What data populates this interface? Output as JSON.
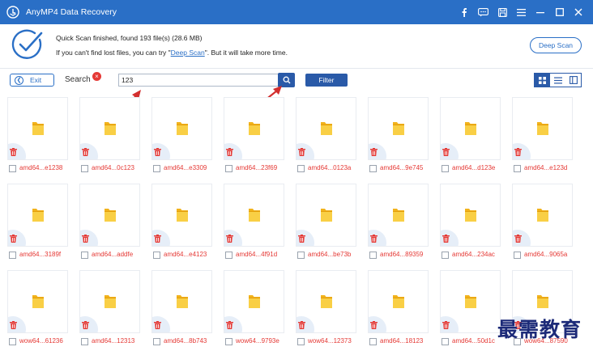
{
  "window": {
    "title": "AnyMP4 Data Recovery",
    "icons": [
      "facebook-icon",
      "chat-icon",
      "save-icon",
      "menu-icon",
      "minimize-icon",
      "maximize-icon",
      "close-icon"
    ]
  },
  "status": {
    "line1": "Quick Scan finished, found 193 file(s) (28.6 MB)",
    "line2_prefix": "If you can't find lost files, you can try \"",
    "line2_link": "Deep Scan",
    "line2_suffix": "\". But it will take more time.",
    "deep_scan_label": "Deep Scan"
  },
  "toolbar": {
    "exit_label": "Exit",
    "search_label": "Search",
    "search_value": "123",
    "filter_label": "Filter",
    "view_modes": [
      "grid",
      "list",
      "detail"
    ],
    "active_view": "grid"
  },
  "colors": {
    "titlebar": "#2a6fc6",
    "accent": "#2a5aa8",
    "filename_red": "#e53935",
    "arrow_red": "#d32f2f"
  },
  "files": [
    [
      "amd64...e1238",
      "amd64...0c123",
      "amd64...e3309",
      "amd64...23f69",
      "amd64...0123a",
      "amd64...9e745",
      "amd64...d123e",
      "amd64...e123d"
    ],
    [
      "amd64...3189f",
      "amd64...addfe",
      "amd64...e4123",
      "amd64...4f91d",
      "amd64...be73b",
      "amd64...89359",
      "amd64...234ac",
      "amd64...9065a"
    ],
    [
      "wow64...61236",
      "amd64...12313",
      "amd64...8b743",
      "wow64...9793e",
      "wow64...12373",
      "amd64...18123",
      "amd64...50d1c",
      "wow64...87590"
    ]
  ],
  "watermark": "最需教育"
}
